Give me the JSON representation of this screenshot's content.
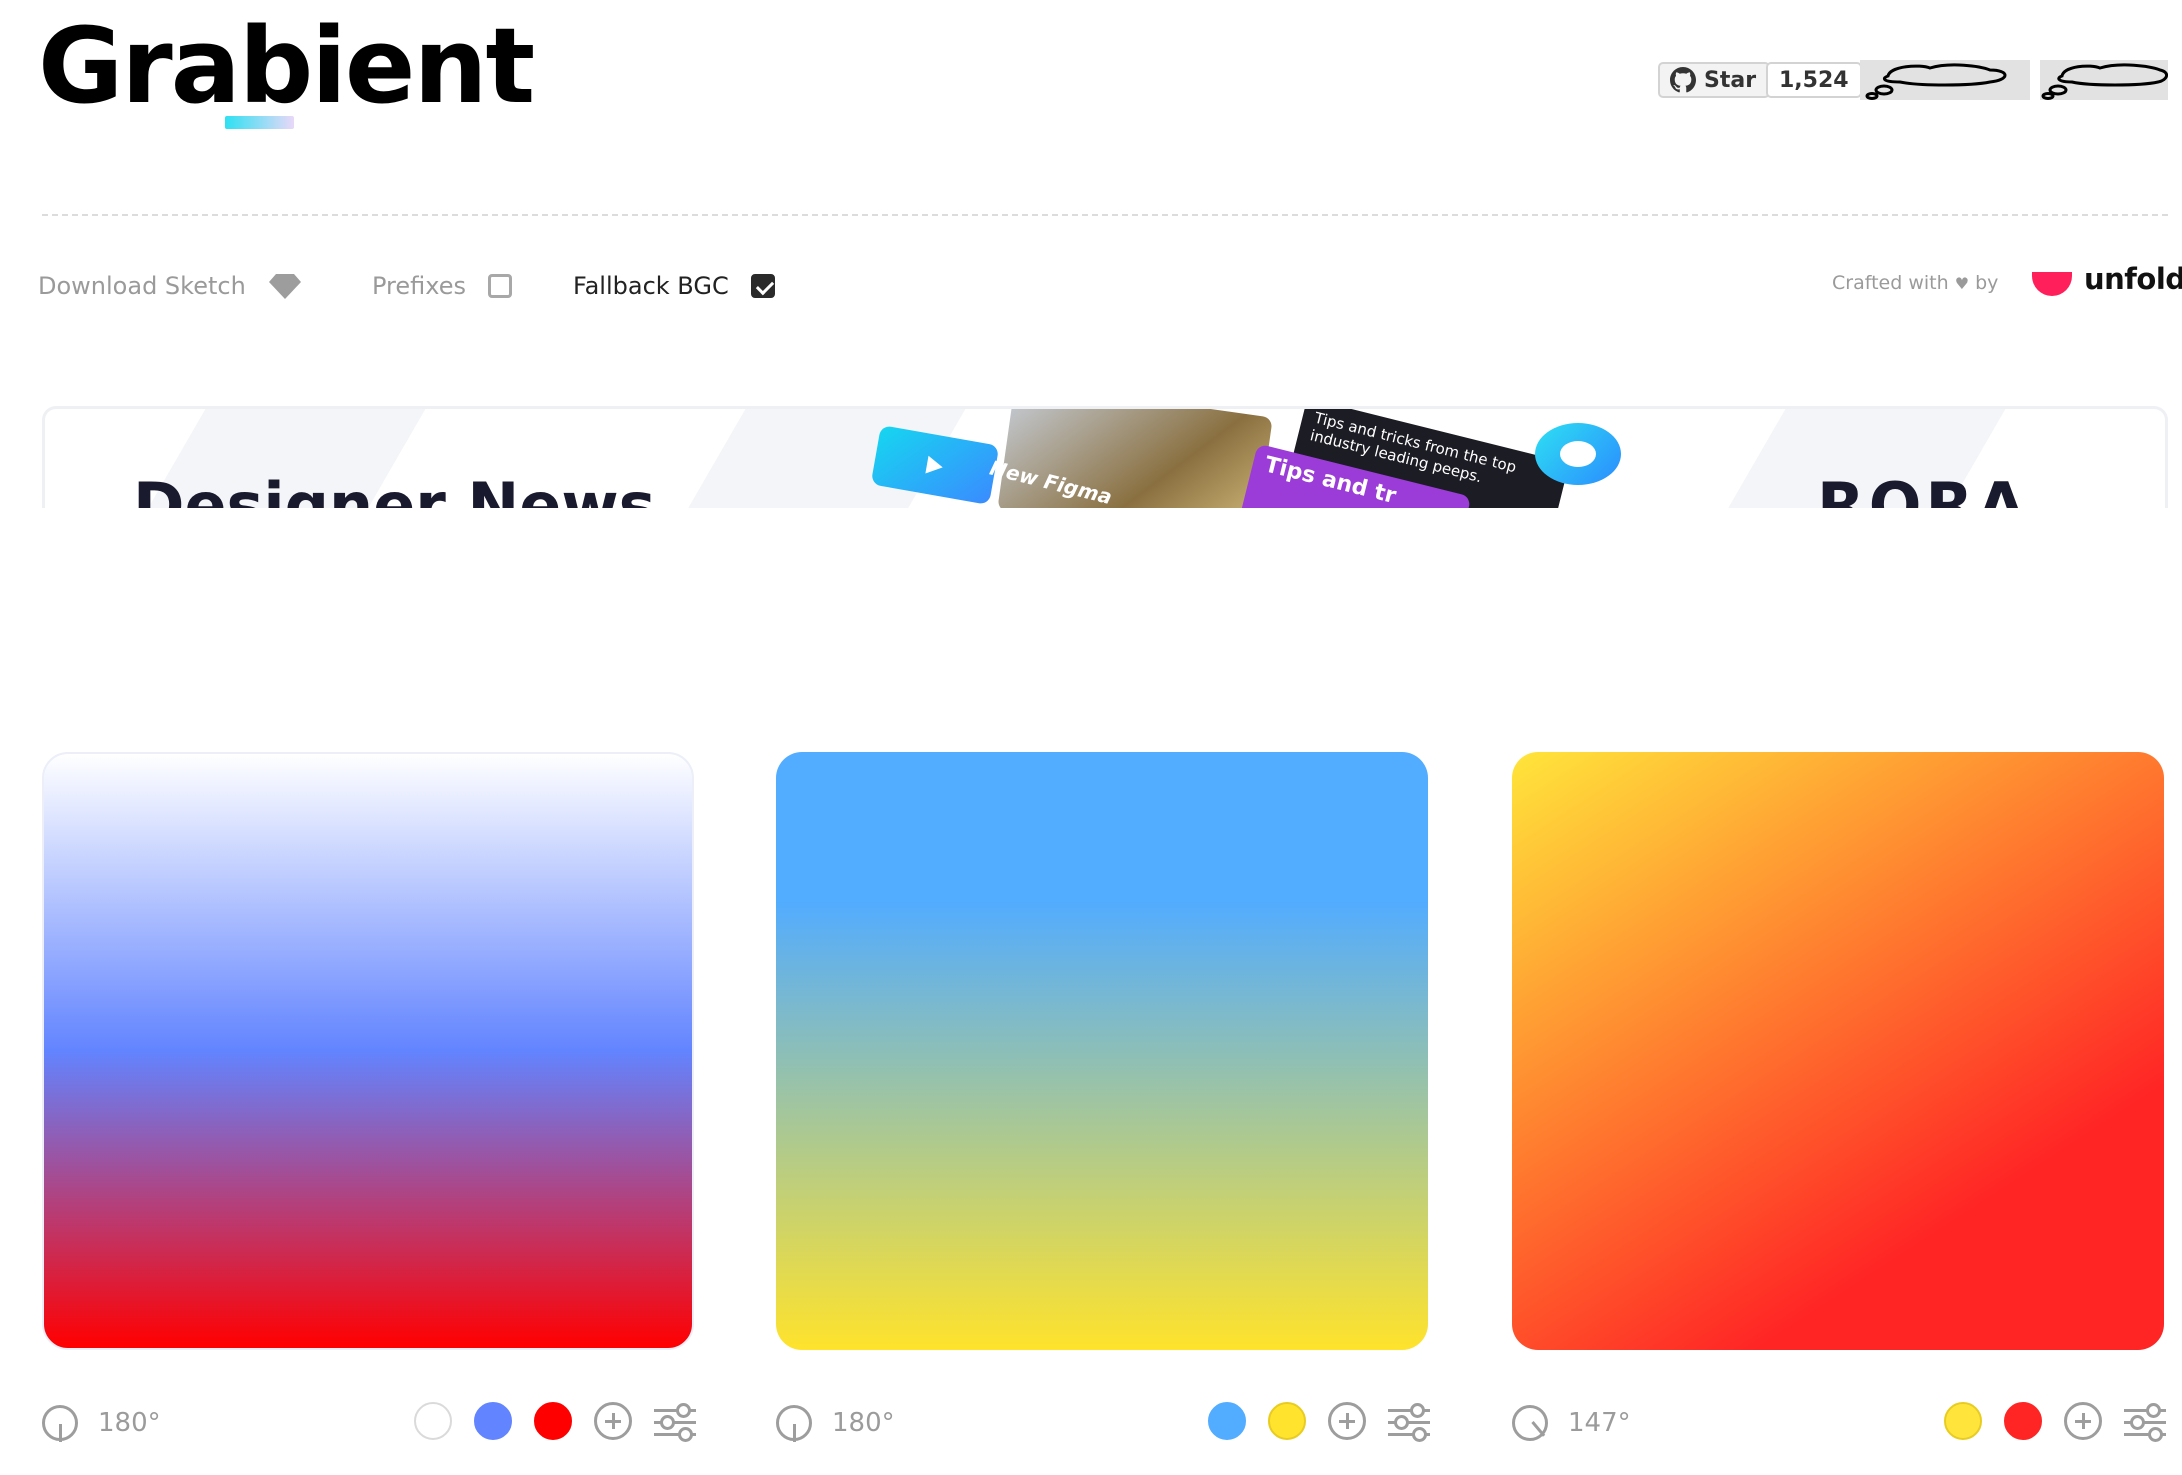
{
  "header": {
    "logo": "Grabient",
    "github": {
      "star_label": "Star",
      "count": "1,524"
    }
  },
  "toolbar": {
    "download_label": "Download Sketch",
    "prefixes_label": "Prefixes",
    "prefixes_checked": false,
    "fallback_label": "Fallback BGC",
    "fallback_checked": true,
    "crafted_label": "Crafted with",
    "crafted_by": "by",
    "brand": "unfold",
    "brand_color": "#ff1f5a"
  },
  "banner": {
    "title": "Designer News",
    "card_text_1": "Tips and tricks from the top industry leading peeps.",
    "card_text_2": "Tips and tr",
    "card_text_3": "New Figma",
    "brand": "RORA"
  },
  "gradients": [
    {
      "angle": "180°",
      "stops": [
        "#ffffff",
        "#6284ff",
        "#ff0000"
      ]
    },
    {
      "angle": "180°",
      "stops": [
        "#52acff",
        "#ffe32c"
      ]
    },
    {
      "angle": "147°",
      "stops": [
        "#ffe53b",
        "#ff2525"
      ]
    }
  ]
}
